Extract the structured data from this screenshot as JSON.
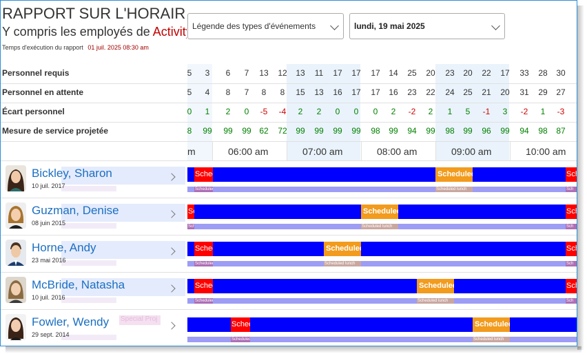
{
  "report": {
    "title": "RAPPORT SUR L'HORAIRE DE",
    "subtitle_prefix": "Y compris les employés de",
    "subtitle_accent": "Activity",
    "runtime_label": "Temps d'exécution du rapport",
    "runtime_value": "01 juil. 2025 08:30 am"
  },
  "controls": {
    "legend_dropdown": "Légende des types d'événements",
    "date_dropdown": "lundi, 19 mai 2025"
  },
  "stats": {
    "labels": {
      "required": "Personnel requis",
      "waiting": "Personnel en attente",
      "gap": "Écart personnel",
      "service": "Mesure de service projetée"
    },
    "required": [
      "5",
      "3",
      "6",
      "7",
      "13",
      "12",
      "13",
      "11",
      "17",
      "17",
      "17",
      "14",
      "25",
      "20",
      "23",
      "20",
      "22",
      "17",
      "33",
      "28",
      "30"
    ],
    "waiting": [
      "5",
      "4",
      "8",
      "7",
      "8",
      "8",
      "15",
      "13",
      "16",
      "17",
      "17",
      "16",
      "23",
      "22",
      "24",
      "25",
      "21",
      "20",
      "31",
      "29",
      "27"
    ],
    "gap": [
      "0",
      "1",
      "2",
      "0",
      "-5",
      "-4",
      "2",
      "2",
      "0",
      "0",
      "0",
      "2",
      "-2",
      "2",
      "1",
      "5",
      "-1",
      "3",
      "-2",
      "1",
      "-3"
    ],
    "service": [
      "8",
      "99",
      "99",
      "99",
      "62",
      "72",
      "99",
      "99",
      "99",
      "99",
      "98",
      "99",
      "94",
      "99",
      "98",
      "99",
      "96",
      "99",
      "94",
      "98",
      "87"
    ]
  },
  "timeline": {
    "first_partial": "m",
    "hours": [
      "06:00 am",
      "07:00 am",
      "08:00 am",
      "09:00 am",
      "10:00 am"
    ]
  },
  "employees": [
    {
      "name": "Bickley, Sharon",
      "date": "10 juil. 2017"
    },
    {
      "name": "Guzman, Denise",
      "date": "08 juin 2015"
    },
    {
      "name": "Horne, Andy",
      "date": "23 mai 2016"
    },
    {
      "name": "McBride, Natasha",
      "date": "10 juil. 2016"
    },
    {
      "name": "Fowler, Wendy",
      "date": "29 sept. 2014",
      "ghost_label": "Special Proj"
    }
  ],
  "events": {
    "sched_short": "Sched",
    "sched_cut": "Schec",
    "sched_other": "Sche",
    "lunch_long": "Scheduled l",
    "lunch_sub": "Scheduled lunch",
    "sub_short": "Scheduled",
    "sub_tiny": "Sched",
    "sub_cut": "Sch"
  },
  "colors": {
    "shift": "#0000ff",
    "event_red": "#ff0000",
    "event_orange": "#f29b1d",
    "positive": "#008000",
    "negative": "#d00000",
    "name_link": "#1b6fc2"
  }
}
